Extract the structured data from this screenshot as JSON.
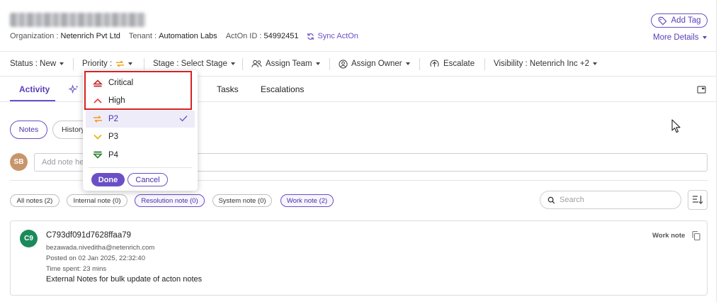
{
  "header": {
    "add_tag_label": "Add Tag",
    "more_details_label": "More Details",
    "org_label": "Organization :",
    "org_value": "Netenrich Pvt Ltd",
    "tenant_label": "Tenant :",
    "tenant_value": "Automation Labs",
    "acton_label": "ActOn ID :",
    "acton_value": "54992451",
    "sync_label": "Sync ActOn"
  },
  "toolbar": {
    "status": "Status : New",
    "priority": "Priority :",
    "stage": "Stage : Select Stage",
    "assign_team": "Assign Team",
    "assign_owner": "Assign Owner",
    "escalate": "Escalate",
    "visibility": "Visibility : Netenrich Inc +2"
  },
  "tabs": {
    "activity": "Activity",
    "tasks": "Tasks",
    "escalations": "Escalations"
  },
  "notes_toggle": {
    "notes": "Notes",
    "history": "History"
  },
  "composer": {
    "avatar": "SB",
    "placeholder": "Add note he"
  },
  "filters": {
    "all": "All notes (2)",
    "internal": "Internal note (0)",
    "resolution": "Resolution note (0)",
    "system": "System note (0)",
    "work": "Work note (2)"
  },
  "search": {
    "placeholder": "Search"
  },
  "note": {
    "avatar": "C9",
    "id": "C793df091d7628ffaa79",
    "author": "bezawada.niveditha@netenrich.com",
    "posted": "Posted on 02 Jan 2025, 22:32:40",
    "time_spent": "Time spent: 23 mins",
    "body": "External Notes for bulk update of acton notes",
    "type": "Work note"
  },
  "priority_dropdown": {
    "items": [
      {
        "label": "Critical",
        "icon": "critical-icon",
        "color": "#c62828"
      },
      {
        "label": "High",
        "icon": "high-icon",
        "color": "#e53935"
      },
      {
        "label": "P2",
        "icon": "p2-icon",
        "color": "#f39c12",
        "selected": true
      },
      {
        "label": "P3",
        "icon": "p3-icon",
        "color": "#e0b400"
      },
      {
        "label": "P4",
        "icon": "p4-icon",
        "color": "#2e7d32"
      }
    ],
    "done_label": "Done",
    "cancel_label": "Cancel"
  },
  "colors": {
    "accent": "#6a4fc6",
    "highlight": "#d62222",
    "avatar_sb": "#c8956b",
    "avatar_c9": "#1b8a5a"
  }
}
